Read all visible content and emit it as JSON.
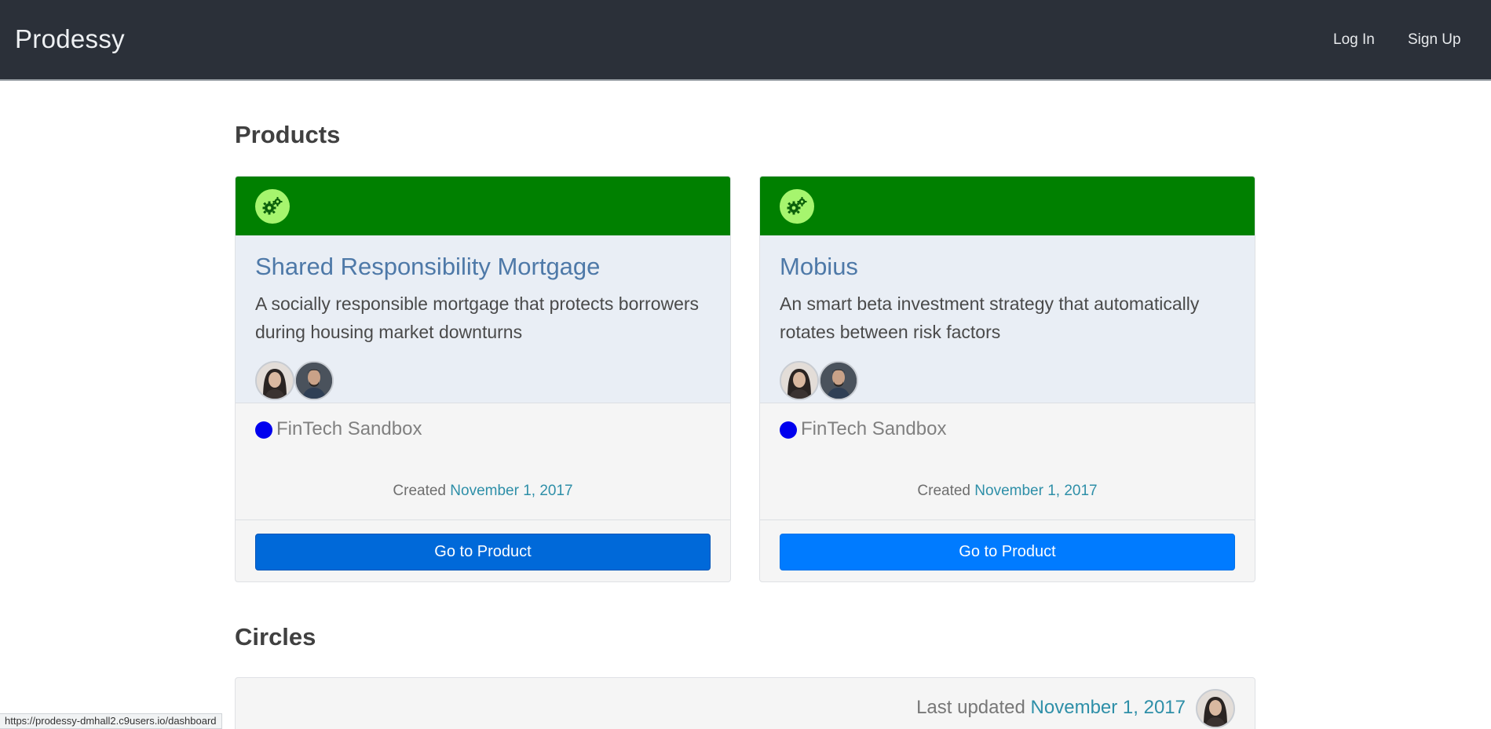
{
  "navbar": {
    "brand": "Prodessy",
    "login": "Log In",
    "signup": "Sign Up"
  },
  "sections": {
    "products": "Products",
    "circles": "Circles"
  },
  "products": [
    {
      "title": "Shared Responsibility Mortgage",
      "description": "A socially responsible mortgage that protects borrowers during housing market downturns",
      "team": "FinTech Sandbox",
      "created_label": "Created",
      "created_date": "November 1, 2017",
      "button": "Go to Product",
      "icon": "gears-icon"
    },
    {
      "title": "Mobius",
      "description": "An smart beta investment strategy that automatically rotates between risk factors",
      "team": "FinTech Sandbox",
      "created_label": "Created",
      "created_date": "November 1, 2017",
      "button": "Go to Product",
      "icon": "gears-icon"
    }
  ],
  "circles": {
    "updated_label": "Last updated",
    "updated_date": "November 1, 2017"
  },
  "status_bar": "https://prodessy-dmhall2.c9users.io/dashboard",
  "colors": {
    "navbar_bg": "#2b3039",
    "card_header": "#008000",
    "gear_badge": "#a6f56e",
    "card_title": "#4e79a8",
    "link_date": "#2e8fa8",
    "team_dot": "#0000ee",
    "button_primary": "#007bff",
    "button_hover": "#0069d9"
  }
}
